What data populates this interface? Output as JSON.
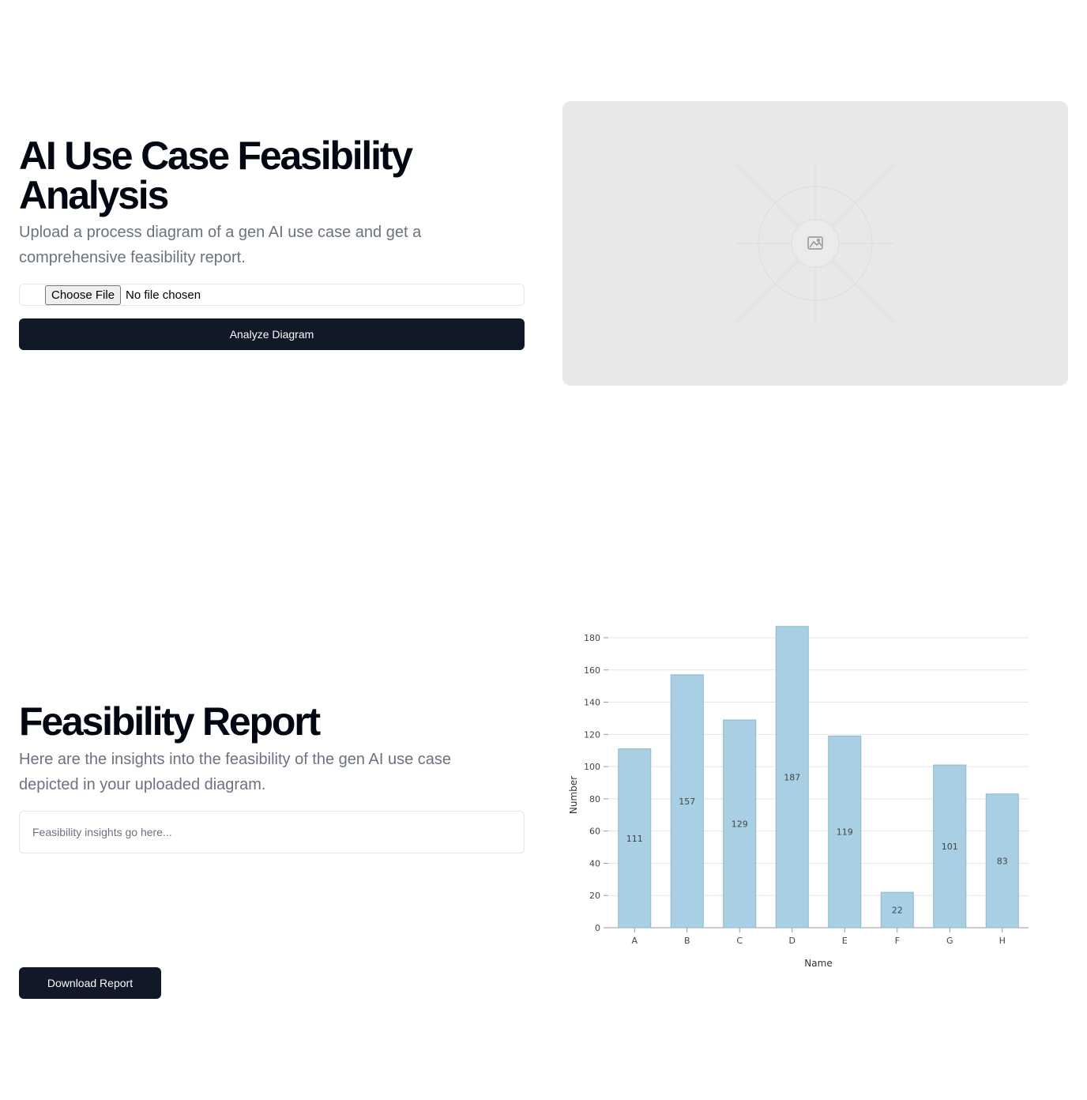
{
  "hero": {
    "title": "AI Use Case Feasibility Analysis",
    "subtitle": "Upload a process diagram of a gen AI use case and get a comprehensive feasibility report."
  },
  "upload": {
    "choose_label": "Choose File",
    "status": "No file chosen",
    "analyze_label": "Analyze Diagram"
  },
  "image_placeholder": {
    "icon": "image-icon"
  },
  "report": {
    "title": "Feasibility Report",
    "subtitle": "Here are the insights into the feasibility of the gen AI use case depicted in your uploaded diagram.",
    "insights_placeholder": "Feasibility insights go here...",
    "download_label": "Download Report"
  },
  "chart_data": {
    "type": "bar",
    "categories": [
      "A",
      "B",
      "C",
      "D",
      "E",
      "F",
      "G",
      "H"
    ],
    "values": [
      111,
      157,
      129,
      187,
      119,
      22,
      101,
      83
    ],
    "xlabel": "Name",
    "ylabel": "Number",
    "yticks": [
      0,
      20,
      40,
      60,
      80,
      100,
      120,
      140,
      160,
      180
    ],
    "ylim": [
      0,
      180
    ],
    "grid": true,
    "bar_color": "#a8cfe3",
    "bar_stroke": "#8fb7cc"
  }
}
